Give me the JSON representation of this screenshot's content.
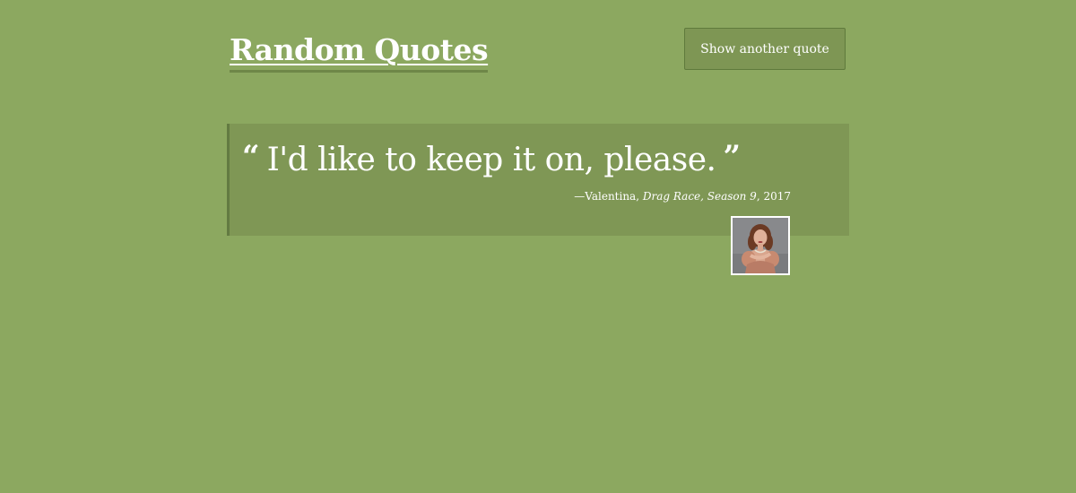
{
  "header": {
    "title": "Random Quotes",
    "new_quote_label": "Show another quote"
  },
  "quote": {
    "open_mark": "“",
    "text": "I'd like to keep it on, please.",
    "close_mark": "”",
    "author": "—Valentina",
    "separator": ", ",
    "source": "Drag Race, Season 9",
    "year_text": ", 2017"
  },
  "colors": {
    "background": "#8ca860",
    "card": "#7f9755",
    "accent": "#637b42"
  }
}
